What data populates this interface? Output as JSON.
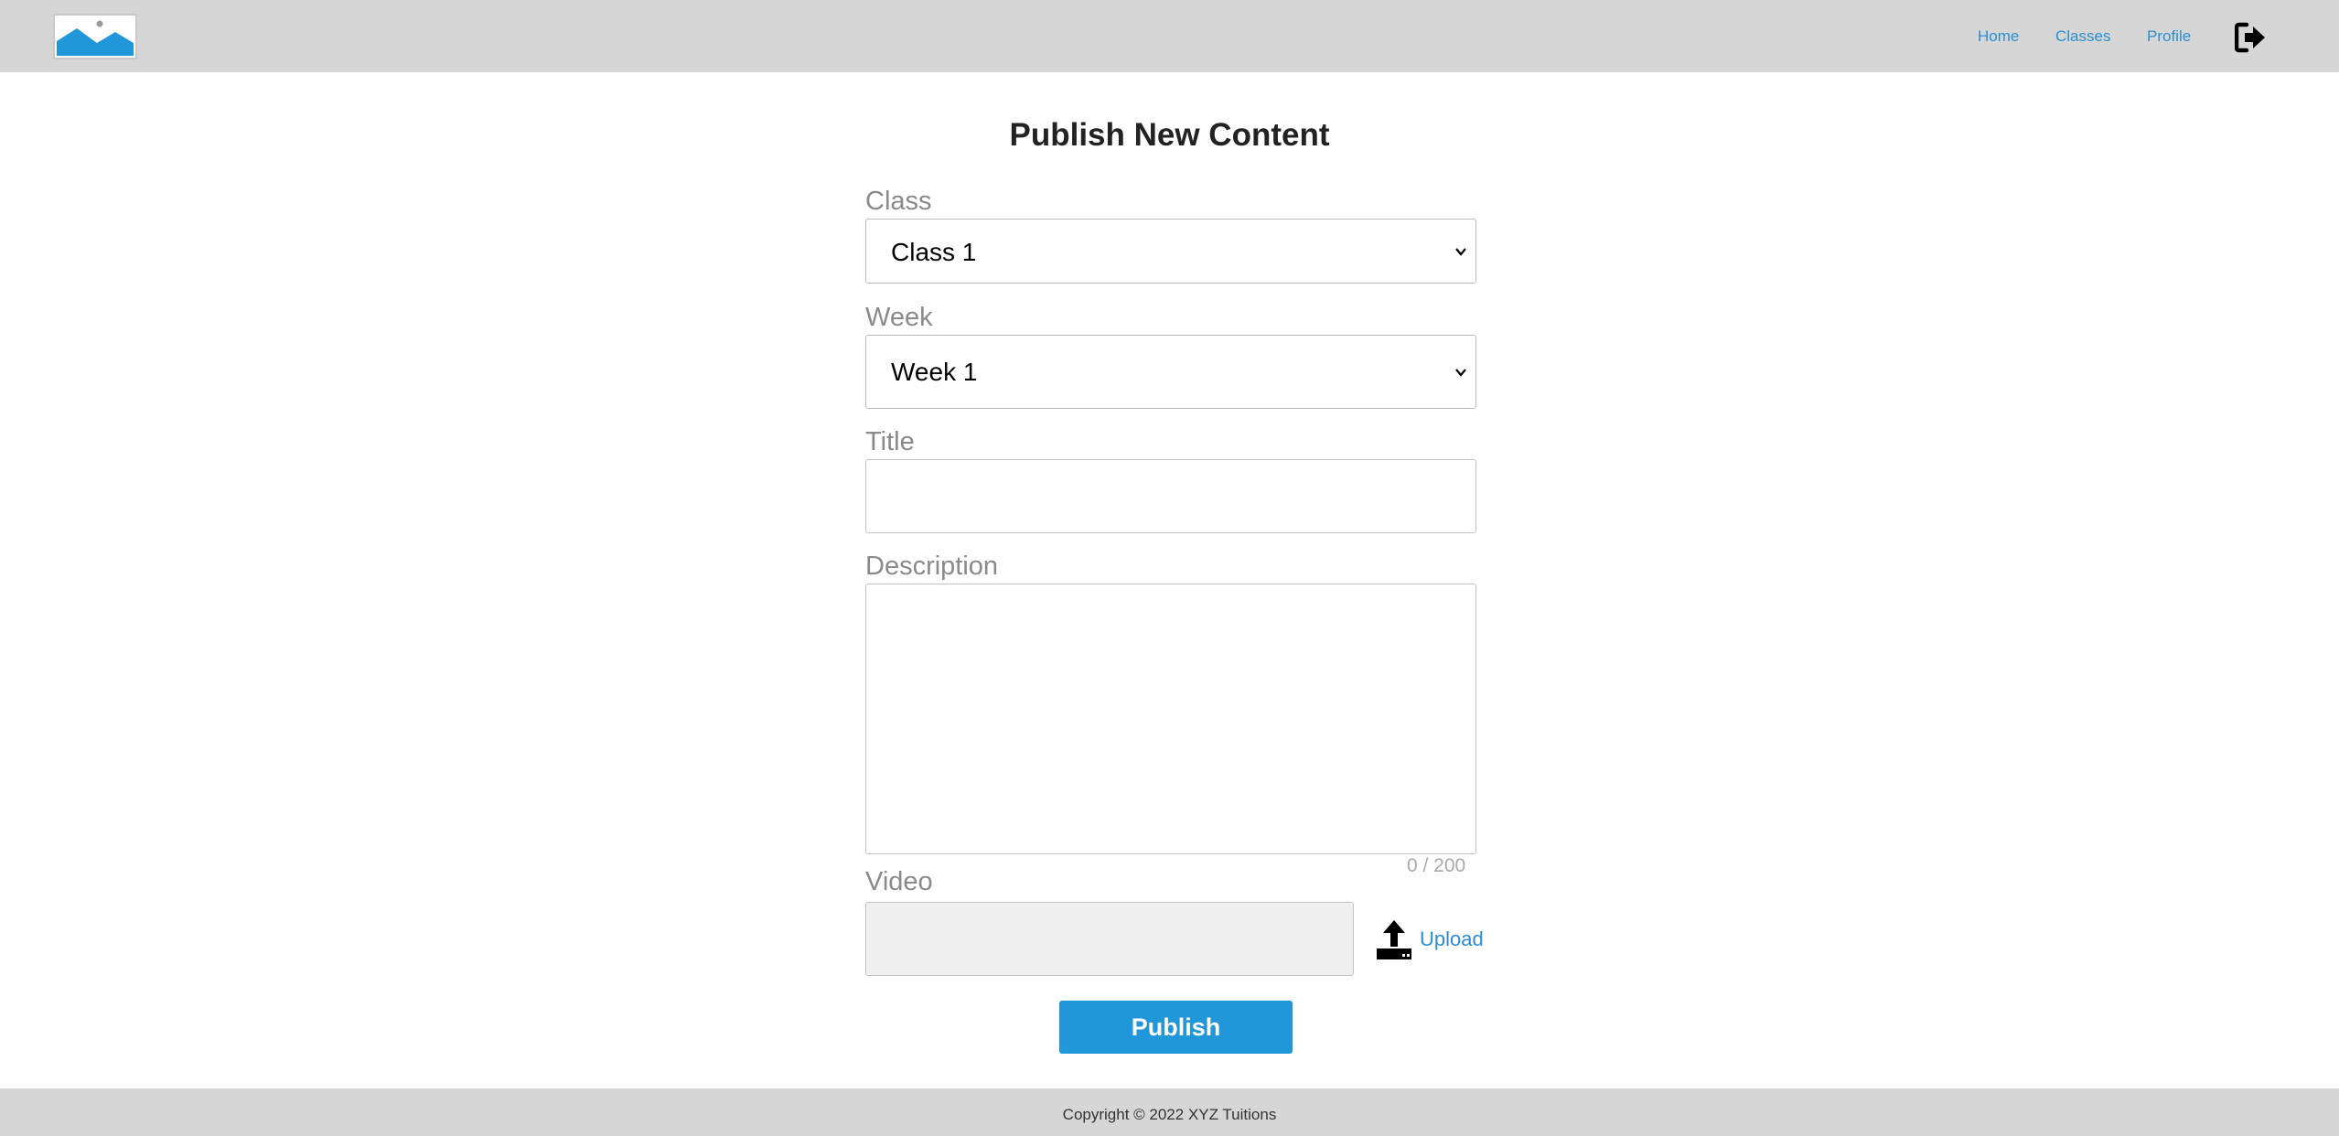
{
  "header": {
    "nav": [
      {
        "label": "Home"
      },
      {
        "label": "Classes"
      },
      {
        "label": "Profile"
      }
    ],
    "logo_icon": "image-placeholder-icon",
    "logout_icon": "sign-out-icon"
  },
  "form": {
    "title": "Publish New Content",
    "class": {
      "label": "Class",
      "value": "Class 1"
    },
    "week": {
      "label": "Week",
      "value": "Week 1"
    },
    "title_field": {
      "label": "Title",
      "value": ""
    },
    "description": {
      "label": "Description",
      "value": "",
      "counter": "0 / 200"
    },
    "video": {
      "label": "Video",
      "value": "",
      "upload_label": "Upload",
      "upload_icon": "upload-icon"
    },
    "publish_label": "Publish"
  },
  "footer": {
    "copyright": "Copyright © 2022 XYZ Tuitions"
  },
  "colors": {
    "accent": "#2196d8",
    "link": "#2a8fcf",
    "header_bg": "#d6d6d6",
    "label": "#8a8a8a"
  }
}
